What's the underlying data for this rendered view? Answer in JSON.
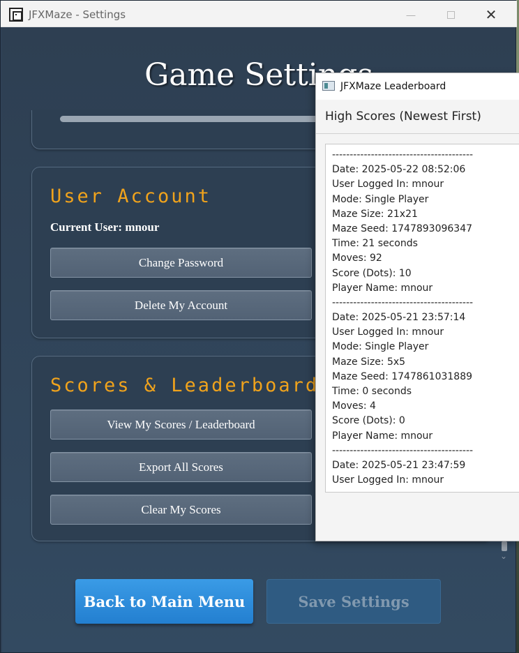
{
  "window": {
    "title": "JFXMaze - Settings",
    "minimize_glyph": "—",
    "close_glyph": "✕"
  },
  "page": {
    "title": "Game Settings"
  },
  "user_account": {
    "title": "User Account",
    "current_user": "Current User: mnour",
    "change_password": "Change Password",
    "delete_account": "Delete My Account"
  },
  "scores": {
    "title": "Scores & Leaderboard",
    "view_scores": "View My Scores / Leaderboard",
    "export_scores": "Export All Scores",
    "clear_scores": "Clear My Scores"
  },
  "footer": {
    "back": "Back to Main Menu",
    "save": "Save Settings"
  },
  "leaderboard": {
    "window_title": "JFXMaze Leaderboard",
    "heading": "High Scores (Newest First)",
    "lines": [
      "----------------------------------------",
      "Date: 2025-05-22 08:52:06",
      "User Logged In: mnour",
      "Mode: Single Player",
      "Maze Size: 21x21",
      "Maze Seed: 1747893096347",
      "Time: 21 seconds",
      "Moves: 92",
      "Score (Dots): 10",
      "Player Name: mnour",
      "----------------------------------------",
      "Date: 2025-05-21 23:57:14",
      "User Logged In: mnour",
      "Mode: Single Player",
      "Maze Size: 5x5",
      "Maze Seed: 1747861031889",
      "Time: 0 seconds",
      "Moves: 4",
      "Score (Dots): 0",
      "Player Name: mnour",
      "----------------------------------------",
      "Date: 2025-05-21 23:47:59",
      "User Logged In: mnour"
    ]
  },
  "colors": {
    "accent_orange": "#f0a31c",
    "primary_button": "#2f8fe0",
    "background": "#2f4156"
  },
  "icons": [
    "app-maze-icon",
    "minimize-icon",
    "maximize-icon",
    "close-icon",
    "leaderboard-app-icon",
    "scroll-down-icon"
  ]
}
